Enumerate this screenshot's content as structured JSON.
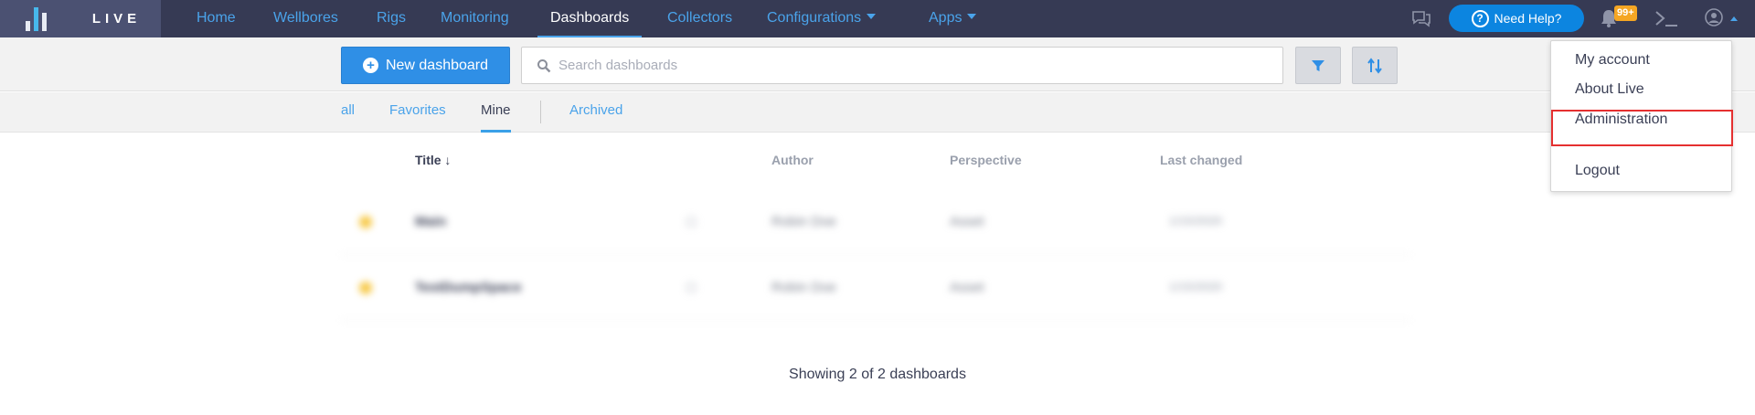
{
  "brand": {
    "name": "LIVE"
  },
  "nav": {
    "items": [
      {
        "label": "Home"
      },
      {
        "label": "Wellbores"
      },
      {
        "label": "Rigs"
      },
      {
        "label": "Monitoring"
      },
      {
        "label": "Dashboards",
        "active": true
      },
      {
        "label": "Collectors"
      },
      {
        "label": "Configurations",
        "dropdown": true
      },
      {
        "label": "Apps",
        "dropdown": true
      }
    ]
  },
  "header": {
    "help_label": "Need Help?",
    "notification_count": "99+",
    "icons": [
      "chat-icon",
      "help-icon",
      "bell-icon",
      "terminal-icon",
      "user-icon"
    ]
  },
  "toolbar": {
    "new_dashboard_label": "New dashboard",
    "search_placeholder": "Search dashboards",
    "filter_icon": "filter-icon",
    "sort_icon": "sort-icon"
  },
  "tabs": [
    {
      "label": "all"
    },
    {
      "label": "Favorites"
    },
    {
      "label": "Mine",
      "active": true
    },
    {
      "label": "Archived"
    }
  ],
  "table": {
    "columns": {
      "title": "Title ↓",
      "author": "Author",
      "perspective": "Perspective",
      "last_changed": "Last changed"
    },
    "rows": [
      {
        "title": "Main",
        "author": "Robin Doe",
        "perspective": "Asset",
        "last_changed": "1/15/2020"
      },
      {
        "title": "TestDumpSpace",
        "author": "Robin Doe",
        "perspective": "Asset",
        "last_changed": "1/15/2020"
      }
    ]
  },
  "footer": {
    "showing_text": "Showing 2 of 2 dashboards"
  },
  "user_menu": {
    "items": [
      {
        "label": "My account"
      },
      {
        "label": "About Live"
      },
      {
        "label": "Administration",
        "highlighted": true
      },
      {
        "label": "Logout"
      }
    ]
  },
  "colors": {
    "navbar": "#363a54",
    "accent": "#4aa3ea",
    "primary_button": "#2f8fe6",
    "badge": "#f5a623",
    "highlight_border": "#e53030"
  }
}
